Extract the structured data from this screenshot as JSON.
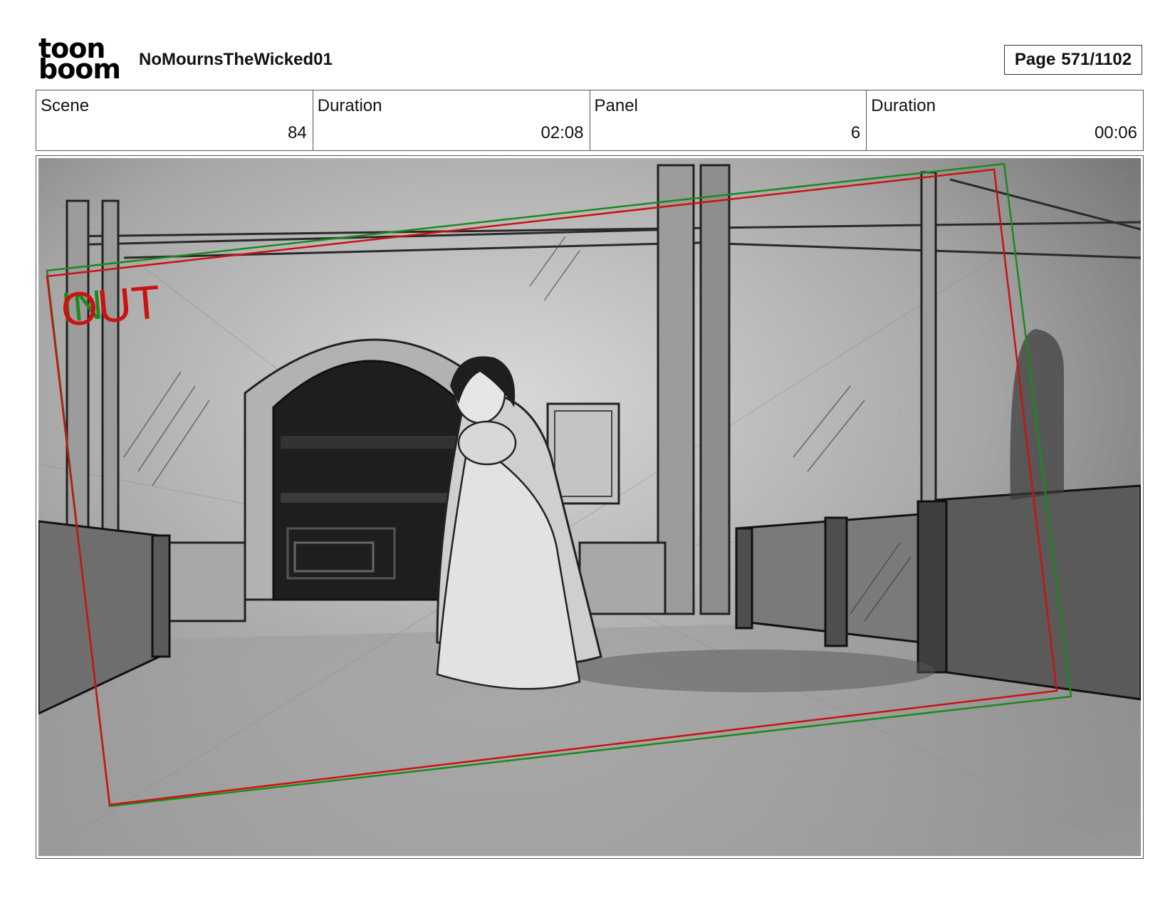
{
  "header": {
    "logo": {
      "line1": "toon",
      "line2": "boom"
    },
    "project_title": "NoMournsTheWicked01",
    "page": {
      "label": "Page",
      "value": "571/1102"
    }
  },
  "info": {
    "scene": {
      "label": "Scene",
      "value": "84"
    },
    "scene_duration": {
      "label": "Duration",
      "value": "02:08"
    },
    "panel": {
      "label": "Panel",
      "value": "6"
    },
    "panel_duration": {
      "label": "Duration",
      "value": "00:06"
    }
  },
  "panel": {
    "camera_in_label": "IN",
    "camera_out_label": "OUT",
    "colors": {
      "camera_in": "#1a8a1a",
      "camera_out": "#cc1111"
    }
  }
}
